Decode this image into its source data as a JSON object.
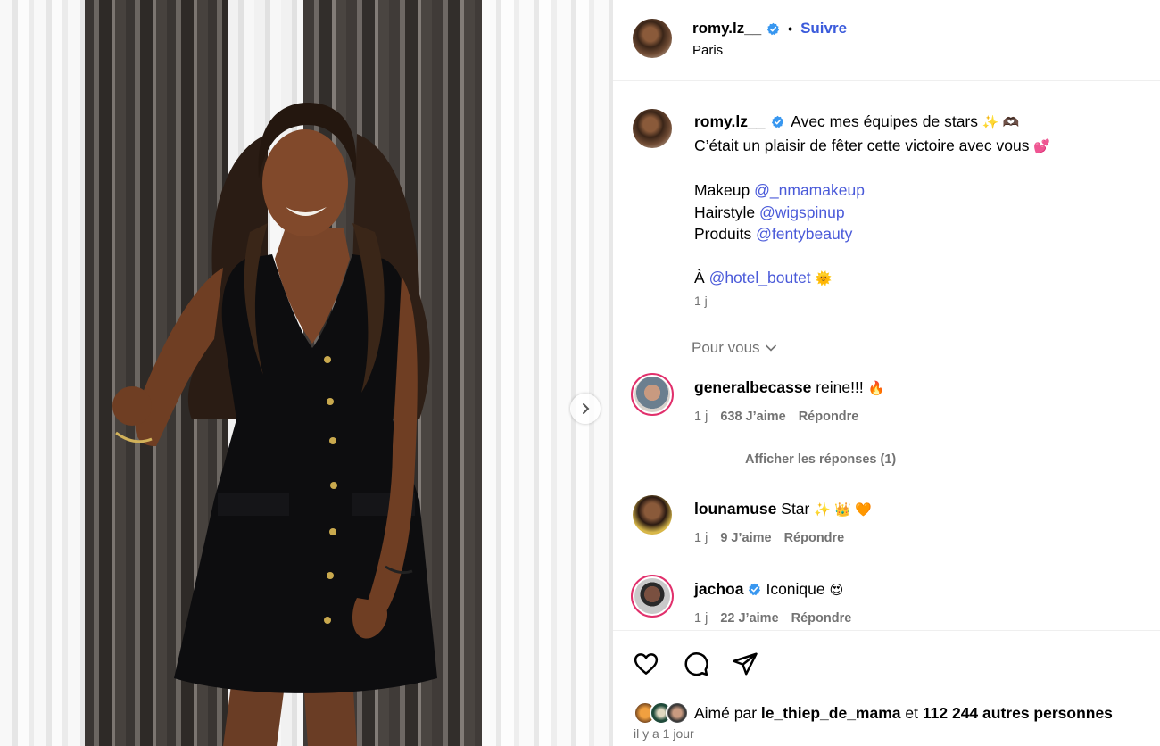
{
  "post": {
    "author": "romy.lz__",
    "follow_label": "Suivre",
    "location": "Paris",
    "verified": true
  },
  "caption": {
    "username": "romy.lz__",
    "line1": "Avec mes équipes de stars",
    "line1_emojis": "✨ 🫶🏿",
    "line2": "C’était un plaisir de fêter cette victoire avec vous",
    "line2_emoji": "💕",
    "makeup_label": "Makeup",
    "makeup_mention": "@_nmamakeup",
    "hair_label": "Hairstyle",
    "hair_mention": "@wigspinup",
    "products_label": "Produits",
    "products_mention": "@fentybeauty",
    "at_label": "À",
    "at_mention": "@hotel_boutet",
    "at_emoji": "🌞",
    "time": "1 j"
  },
  "for_you_label": "Pour vous",
  "comments": [
    {
      "username": "generalbecasse",
      "text": "reine!!!",
      "emoji": "🔥",
      "time": "1 j",
      "likes": "638 J’aime",
      "reply_label": "Répondre"
    },
    {
      "username": "lounamuse",
      "text": "Star",
      "emoji": "✨ 👑 🧡",
      "time": "1 j",
      "likes": "9 J’aime",
      "reply_label": "Répondre"
    },
    {
      "username": "jachoa",
      "text": "Iconique",
      "emoji": "😍",
      "time": "1 j",
      "likes": "22 J’aime",
      "reply_label": "Répondre",
      "verified": true
    }
  ],
  "view_replies_label": "Afficher les réponses (1)",
  "likes_summary": {
    "prefix": "Aimé par",
    "user": "le_thiep_de_mama",
    "connector": "et",
    "others": "112 244 autres personnes"
  },
  "posted_ago": "il y a 1 jour",
  "colors": {
    "link": "#4a5ad9",
    "verified": "#3897f0",
    "muted": "#737373",
    "story_ring": "#e1306c"
  },
  "icons": [
    "verified-badge-icon",
    "chevron-right-icon",
    "chevron-down-icon",
    "heart-icon",
    "comment-icon",
    "share-icon"
  ]
}
